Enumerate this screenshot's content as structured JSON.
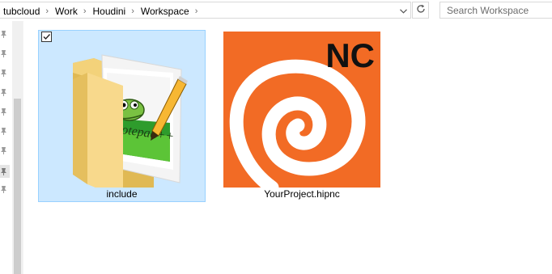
{
  "address": {
    "crumbs": [
      "tubcloud",
      "Work",
      "Houdini",
      "Workspace"
    ],
    "separator": "›"
  },
  "search": {
    "placeholder": "Search Workspace"
  },
  "files": [
    {
      "label": "include",
      "type": "folder",
      "icon": "folder-notepadpp-icon",
      "selected": true,
      "checked": true
    },
    {
      "label": "YourProject.hipnc",
      "type": "houdini-file",
      "icon": "houdini-hipnc-icon",
      "badge": "NC",
      "selected": false
    }
  ],
  "colors": {
    "selection_bg": "#cce8ff",
    "selection_border": "#99d1ff",
    "houdini_orange": "#f26b25"
  }
}
